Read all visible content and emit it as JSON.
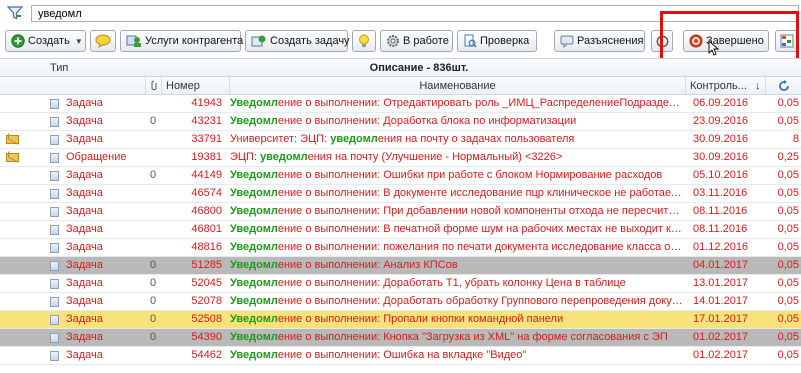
{
  "search": {
    "value": "уведомл"
  },
  "toolbar": {
    "create_label": "Создать",
    "counterparty_services_label": "Услуги контрагента",
    "create_task_label": "Создать задачу",
    "in_work_label": "В работе",
    "check_label": "Проверка",
    "clarifications_label": "Разъяснения",
    "completed_label": "Завершено"
  },
  "grid": {
    "header": {
      "type_label": "Тип",
      "description_title": "Описание - 836шт.",
      "number_label": "Номер",
      "name_label": "Наименование",
      "control_label": "Контроль...",
      "sort_arrow": "↓"
    },
    "rows": [
      {
        "type": "Задача",
        "clip": "",
        "number": "41943",
        "prefix": "Уведомл",
        "rest": "ение о выполнении: Отредактировать роль _ИМЦ_РаспределениеПодразделений...",
        "date": "06.09.2016",
        "val": "0,05",
        "state": ""
      },
      {
        "type": "Задача",
        "clip": "0",
        "number": "43231",
        "prefix": "Уведомл",
        "rest": "ение о выполнении: Доработка блока по информатизации",
        "date": "23.09.2016",
        "val": "0,05",
        "state": ""
      },
      {
        "type": "Задача",
        "clip": "",
        "number": "33791",
        "prefix": "",
        "rest": "Университет: ЭЦП: ",
        "mid": "уведомл",
        "tail": "ения на почту о задачах пользователя",
        "date": "30.09.2016",
        "val": "8",
        "state": "",
        "env": true
      },
      {
        "type": "Обращение",
        "clip": "",
        "number": "19381",
        "prefix": "",
        "rest": "ЭЦП: ",
        "mid": "уведомл",
        "tail": "ения на почту (Улучшение - Нормальный) <3226>",
        "date": "30.09.2016",
        "val": "0,25",
        "state": "",
        "env": true
      },
      {
        "type": "Задача",
        "clip": "0",
        "number": "44149",
        "prefix": "Уведомл",
        "rest": "ение о выполнении: Ошибки при работе с блоком Нормирование расходов",
        "date": "05.10.2016",
        "val": "0,05",
        "state": ""
      },
      {
        "type": "Задача",
        "clip": "",
        "number": "46574",
        "prefix": "Уведомл",
        "rest": "ение о выполнении: В документе исследование пцр клиническое не работает кно...",
        "date": "03.11.2016",
        "val": "0,05",
        "state": ""
      },
      {
        "type": "Задача",
        "clip": "",
        "number": "46800",
        "prefix": "Уведомл",
        "rest": "ение о выполнении: При добавлении новой компоненты отхода не пересчитывает...",
        "date": "08.11.2016",
        "val": "0,05",
        "state": ""
      },
      {
        "type": "Задача",
        "clip": "",
        "number": "46801",
        "prefix": "Уведомл",
        "rest": "ение о выполнении: В печатной форме шум на рабочих местах не выходит кроном...",
        "date": "08.11.2016",
        "val": "0,05",
        "state": ""
      },
      {
        "type": "Задача",
        "clip": "",
        "number": "48816",
        "prefix": "Уведомл",
        "rest": "ение о выполнении: пожелания по печати документа исследование класса опасн...",
        "date": "01.12.2016",
        "val": "0,05",
        "state": ""
      },
      {
        "type": "Задача",
        "clip": "0",
        "number": "51285",
        "prefix": "Уведомл",
        "rest": "ение о выполнении: Анализ КПСов",
        "date": "04.01.2017",
        "val": "0,05",
        "state": "gray"
      },
      {
        "type": "Задача",
        "clip": "0",
        "number": "52045",
        "prefix": "Уведомл",
        "rest": "ение о выполнении: Доработать Т1, убрать колонку Цена в таблице",
        "date": "13.01.2017",
        "val": "0,05",
        "state": ""
      },
      {
        "type": "Задача",
        "clip": "0",
        "number": "52078",
        "prefix": "Уведомл",
        "rest": "ение о выполнении: Доработать обработку Группового перепроведения документ...",
        "date": "14.01.2017",
        "val": "0,05",
        "state": ""
      },
      {
        "type": "Задача",
        "clip": "0",
        "number": "52508",
        "prefix": "Уведомл",
        "rest": "ение о выполнении: Пропали кнопки командной панели",
        "date": "17.01.2017",
        "val": "0,05",
        "state": "yellow"
      },
      {
        "type": "Задача",
        "clip": "0",
        "number": "54390",
        "prefix": "Уведомл",
        "rest": "ение о выполнении: Кнопка \"Загрузка из XML\" на форме согласования с ЭП",
        "date": "01.02.2017",
        "val": "0,05",
        "state": "gray"
      },
      {
        "type": "Задача",
        "clip": "",
        "number": "54462",
        "prefix": "Уведомл",
        "rest": "ение о выполнении: Ошибка на вкладке \"Видео\"",
        "date": "01.02.2017",
        "val": "0,05",
        "state": ""
      }
    ]
  },
  "colors": {
    "text_red": "#d41c1c",
    "match_green": "#1a9b1a",
    "highlight_red": "#e11010",
    "row_gray": "#b9b9b9",
    "row_yellow": "#f8e27a"
  }
}
